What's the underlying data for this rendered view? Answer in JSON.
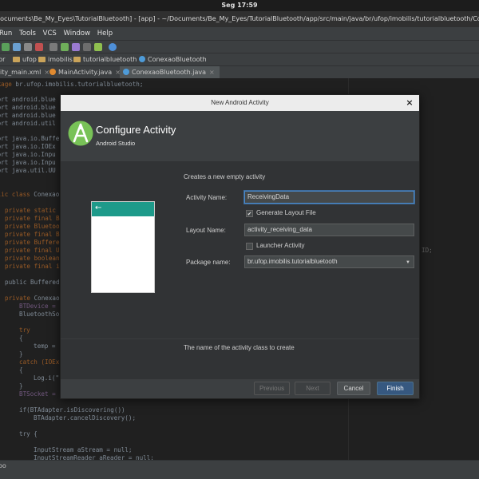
{
  "system": {
    "clock": "Seg 17:59"
  },
  "window": {
    "title": "Documents\\Be_My_Eyes\\TutorialBluetooth] - [app] - ~/Documents/Be_My_Eyes/TutorialBluetooth/app/src/main/java/br/ufop/imobilis/tutorialbluetooth/ConexaoBlue"
  },
  "menu": {
    "items": [
      "Run",
      "Tools",
      "VCS",
      "Window",
      "Help"
    ]
  },
  "nav": {
    "crumbs": [
      "br",
      "ufop",
      "imobilis",
      "tutorialbluetooth",
      "ConexaoBluetooth"
    ]
  },
  "tabs": [
    {
      "label": "ity_main.xml",
      "close": "×"
    },
    {
      "label": "MainActivity.java",
      "close": "×"
    },
    {
      "label": "ConexaoBluetooth.java",
      "close": "×"
    }
  ],
  "code": {
    "package_kw": "ckage",
    "package_name": " br.ufop.imobilis.tutorialbluetooth;",
    "imports": [
      "port android.blue",
      "port android.blue",
      "port android.blue",
      "port android.util",
      "port java.io.Buffe",
      "port java.io.IOEx",
      "port java.io.Inpu",
      "port java.io.Inpu",
      "port java.util.UU"
    ],
    "class_line_kw": "blic class ",
    "class_line_name": "Conexao",
    "fields": [
      "private static",
      "private final B",
      "private Bluetoo",
      "private final B",
      "private Buffere",
      "private final U",
      "private boolean",
      "private final i"
    ],
    "ctor": "public BufferedR",
    "private_conex_kw": "private ",
    "private_conex_name": "ConexaoB",
    "bt_device": "BTDevice = ",
    "bt_socket": "BluetoothSo",
    "try1": "try",
    "brace_open": "{",
    "temp": "temp = ",
    "brace_close": "}",
    "catch": "catch (IOEx",
    "log": "Log.i(\"",
    "btsocket_assign": "BTSocket = ",
    "if_line": "if(BTAdapter.isDiscovering())",
    "cancel_line": "BTAdapter.cancelDiscovery();",
    "try2": "try {",
    "input_line": "InputStream aStream = null;",
    "reader_line": "InputStreamReader aReader = null;",
    "right_id": "ID;"
  },
  "status": {
    "left": "oo"
  },
  "dialog": {
    "title": "New Android Activity",
    "close": "×",
    "header_title": "Configure Activity",
    "header_subtitle": "Android Studio",
    "description": "Creates a new empty activity",
    "preview_back": "←",
    "fields": {
      "activity_name_label": "Activity Name:",
      "activity_name_value": "ReceivingData",
      "generate_layout_label": "Generate Layout File",
      "generate_layout_checked": "✔",
      "layout_name_label": "Layout Name:",
      "layout_name_value": "activity_receiving_data",
      "launcher_label": "Launcher Activity",
      "package_label": "Package name:",
      "package_value": "br.ufop.imobilis.tutorialbluetooth",
      "package_arrow": "▼"
    },
    "hint": "The name of the activity class to create",
    "buttons": {
      "previous": "Previous",
      "next": "Next",
      "cancel": "Cancel",
      "finish": "Finish"
    }
  },
  "colors": {
    "accent": "#4a88c7",
    "preview_bar": "#1e9a8a",
    "android_green": "#78c257"
  }
}
